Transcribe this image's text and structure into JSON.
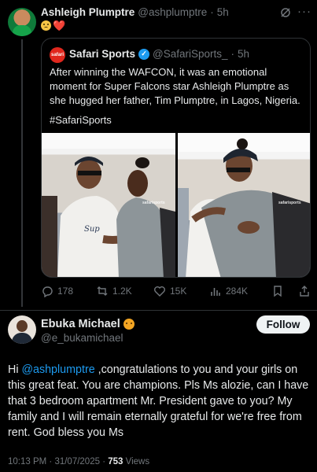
{
  "top_tweet": {
    "name": "Ashleigh Plumptre",
    "handle": "@ashplumptre",
    "dot": "·",
    "time": "5h",
    "heart": "❤️"
  },
  "quote": {
    "avatar_label": "safari",
    "name": "Safari Sports",
    "handle": "@SafariSports_",
    "dot": "·",
    "time": "5h",
    "text": "After winning the WAFCON, it was an emotional moment for Super Falcons star Ashleigh Plumptre as she hugged her father, Tim Plumptre, in Lagos, Nigeria.",
    "hashtag": "#SafariSports",
    "watermark": "safarisports"
  },
  "actions": {
    "replies": "178",
    "reposts": "1.2K",
    "likes": "15K",
    "views": "284K"
  },
  "reply": {
    "name": "Ebuka Michael",
    "handle": "@e_bukamichael",
    "follow_label": "Follow",
    "text_prefix": "Hi ",
    "mention": "@ashplumptre",
    "text_rest": " ,congratulations to you and your girls on this great feat. You are champions.  Pls Ms alozie, can I have that 3 bedroom apartment Mr. President gave to you? My family and I will remain eternally grateful for we're free from rent. God bless you Ms",
    "timestamp": "10:13 PM · 31/07/2025 · ",
    "views_count": "753",
    "views_label": " Views"
  },
  "colors": {
    "background": "#000000",
    "accent": "#1d9bf0",
    "muted": "#71767b",
    "heart": "#f91880"
  }
}
